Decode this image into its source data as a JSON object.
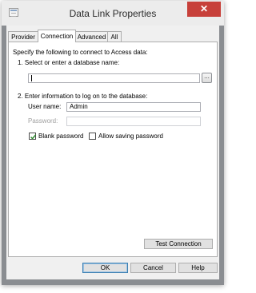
{
  "window": {
    "title": "Data Link Properties",
    "close_glyph": "✕",
    "icon": "data-link-icon"
  },
  "tabs": [
    {
      "label": "Provider",
      "active": false
    },
    {
      "label": "Connection",
      "active": true
    },
    {
      "label": "Advanced",
      "active": false
    },
    {
      "label": "All",
      "active": false
    }
  ],
  "connection": {
    "intro": "Specify the following to connect to Access data:",
    "step1_label": "1. Select or enter a database name:",
    "database_name_value": "",
    "browse_label": "...",
    "step2_label": "2. Enter information to log on to the database:",
    "username_label": "User name:",
    "username_value": "Admin",
    "password_label": "Password:",
    "password_value": "",
    "blank_password": {
      "label": "Blank password",
      "checked": true
    },
    "allow_saving_password": {
      "label": "Allow saving password",
      "checked": false
    },
    "test_connection_label": "Test Connection"
  },
  "buttons": {
    "ok": "OK",
    "cancel": "Cancel",
    "help": "Help"
  },
  "colors": {
    "close_button": "#c7403a",
    "check_mark": "#2f8a2f"
  }
}
